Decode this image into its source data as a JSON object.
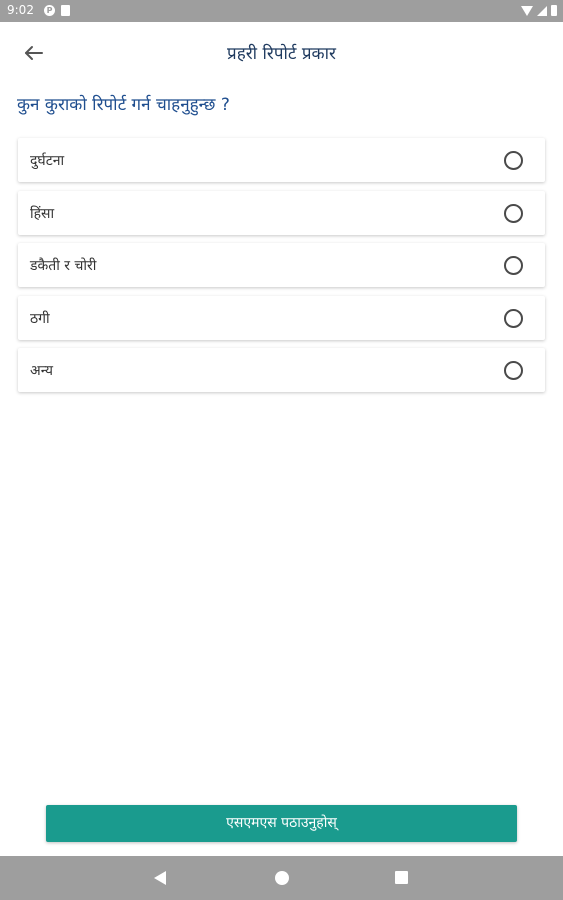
{
  "status_bar": {
    "time": "9:02",
    "icons": [
      "p-notification-icon",
      "sd-card-icon",
      "wifi-icon",
      "signal-icon",
      "battery-icon"
    ]
  },
  "app_bar": {
    "back_icon": "arrow-left-icon",
    "title": "प्रहरी रिपोर्ट प्रकार"
  },
  "question": "कुन कुराको रिपोर्ट गर्न चाहनुहुन्छ ?",
  "options": [
    {
      "label": "दुर्घटना",
      "selected": false
    },
    {
      "label": "हिंसा",
      "selected": false
    },
    {
      "label": "डकैती र चोरी",
      "selected": false
    },
    {
      "label": "ठगी",
      "selected": false
    },
    {
      "label": "अन्य",
      "selected": false
    }
  ],
  "submit": {
    "label": "एसएमएस पठाउनुहोस्"
  },
  "nav_bar": {
    "icons": [
      "nav-back-icon",
      "nav-home-icon",
      "nav-recents-icon"
    ]
  },
  "colors": {
    "status_bar": "#9e9e9e",
    "title_text": "#1f3a5f",
    "question_text": "#1f4e8f",
    "accent_button": "#1a9b8e"
  }
}
